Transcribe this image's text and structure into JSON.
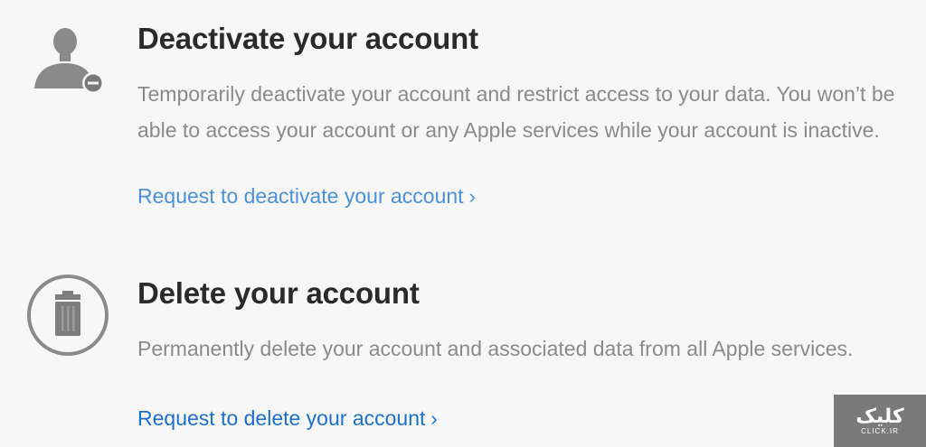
{
  "deactivate": {
    "icon": "person-minus-icon",
    "title": "Deactivate your account",
    "description": "Temporarily deactivate your account and restrict access to your data. You won’t be able to access your account or any Apple services while your account is inactive.",
    "link_label": "Request to deactivate your account",
    "link_chevron": "›"
  },
  "delete": {
    "icon": "trash-icon",
    "title": "Delete your account",
    "description": "Permanently delete your account and associated data from all Apple services.",
    "link_label": "Request to delete your account",
    "link_chevron": "›"
  },
  "watermark": {
    "main": "کلیک",
    "sub": "CLICK.IR"
  },
  "colors": {
    "link": "#1a6fd0",
    "title": "#2a2a2a",
    "description": "#8a8a8a",
    "icon": "#808080",
    "background": "#f7f7f7"
  }
}
